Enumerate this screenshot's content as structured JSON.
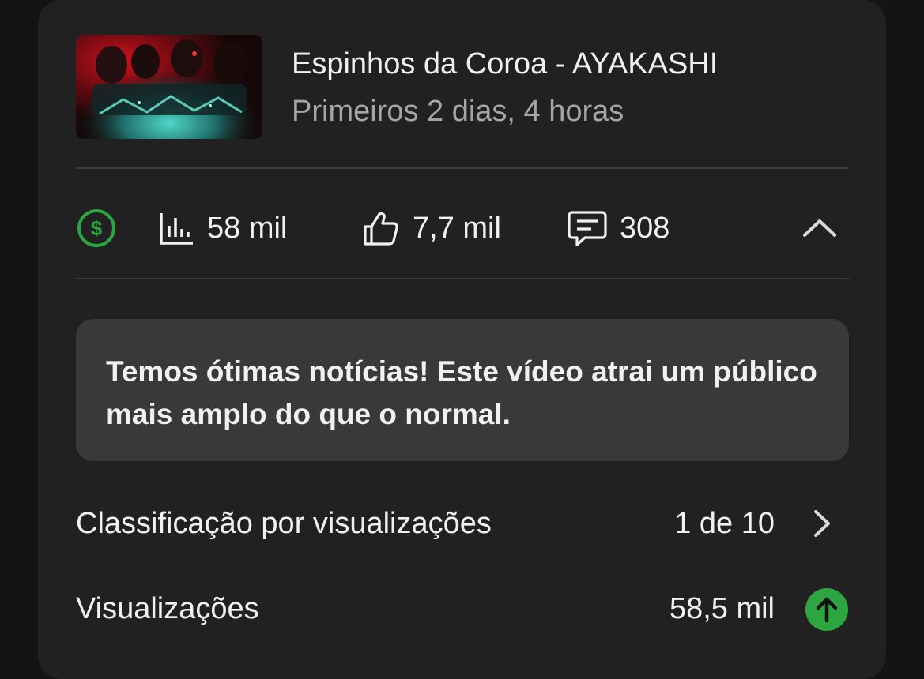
{
  "video": {
    "title": "Espinhos da Coroa - AYAKASHI",
    "subtitle": "Primeiros 2 dias, 4 horas"
  },
  "stats": {
    "monetization_icon": "dollar-circle-icon",
    "views": "58 mil",
    "likes": "7,7 mil",
    "comments": "308"
  },
  "banner": {
    "text": "Temos ótimas notícias! Este vídeo atrai um público mais amplo do que o normal."
  },
  "rows": [
    {
      "label": "Classificação por visualizações",
      "value": "1 de 10",
      "icon": "chevron-right-icon"
    },
    {
      "label": "Visualizações",
      "value": "58,5 mil",
      "icon": "arrow-up-circle-icon"
    }
  ],
  "colors": {
    "background": "#141414",
    "card": "#212121",
    "banner": "#393939",
    "accent_green": "#2ba640",
    "secondary_text": "#a6a6a6"
  }
}
